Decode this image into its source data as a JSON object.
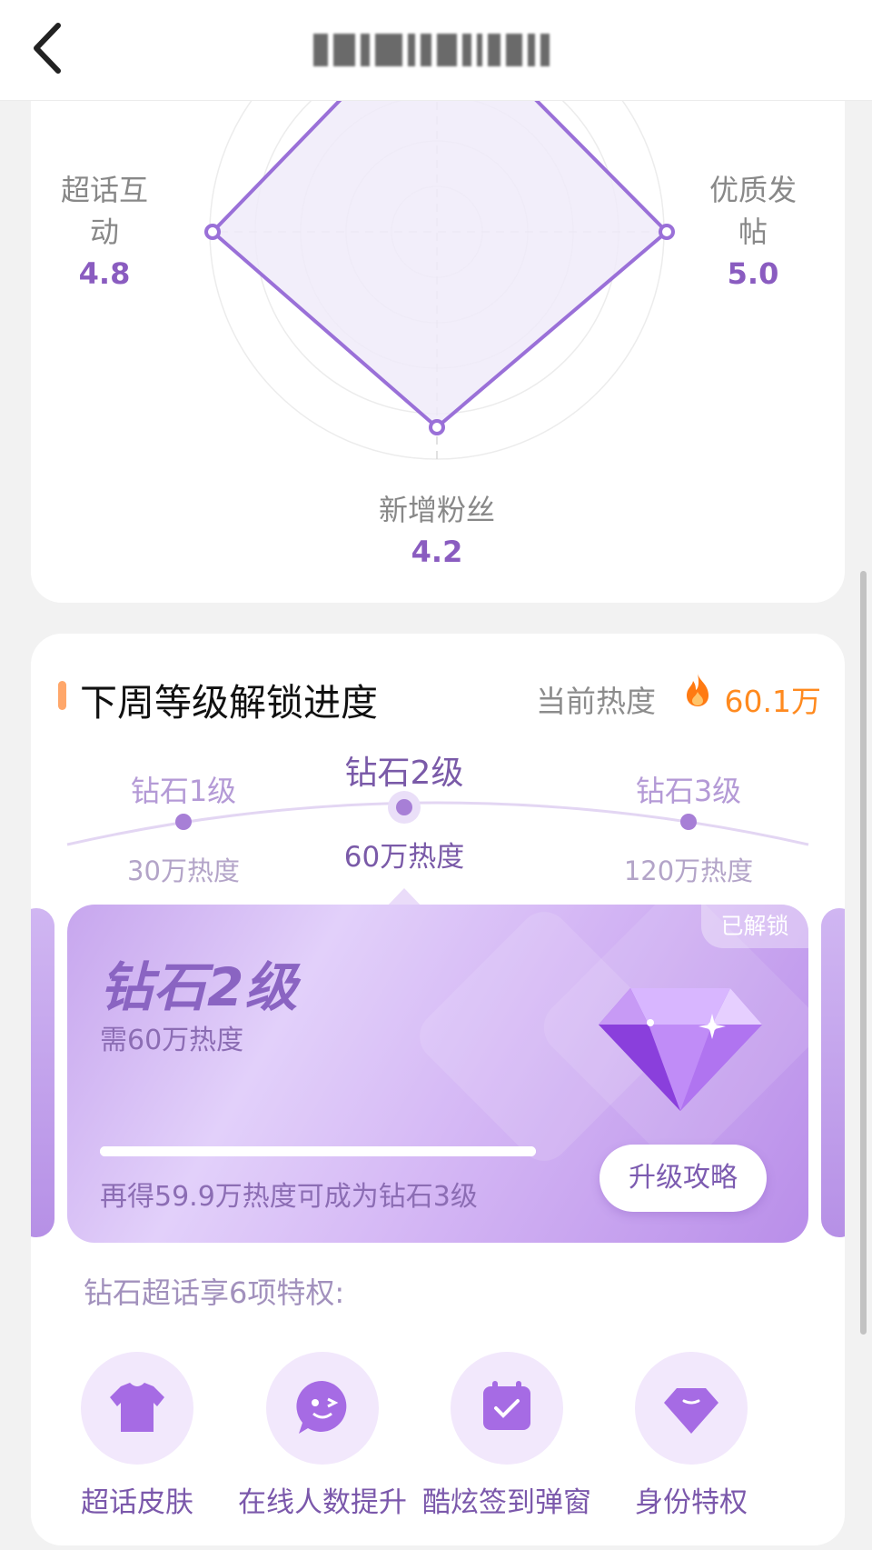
{
  "header": {
    "back_icon": "chevron-left-icon",
    "title": "(blurred)"
  },
  "radar": {
    "axes": [
      {
        "label": "超话互\n动",
        "value": "4.8"
      },
      {
        "label": "优质发\n帖",
        "value": "5.0"
      },
      {
        "label": "新增粉丝",
        "value": "4.2"
      }
    ],
    "colors": {
      "stroke": "#9a70d8",
      "fill": "#f0ebf9"
    }
  },
  "progress_section": {
    "title": "下周等级解锁进度",
    "current_heat_label": "当前热度",
    "current_heat_value": "60.1万",
    "flame_icon": "flame-icon",
    "levels": [
      {
        "name": "钻石1级",
        "heat": "30万热度"
      },
      {
        "name": "钻石2级",
        "heat": "60万热度"
      },
      {
        "name": "钻石3级",
        "heat": "120万热度"
      }
    ],
    "card": {
      "badge": "已解锁",
      "title": "钻石2级",
      "subtitle": "需60万热度",
      "progress": 1.0,
      "tip": "再得59.9万热度可成为钻石3级",
      "button": "升级攻略",
      "gem_icon": "diamond-gem-icon"
    },
    "privileges_title": "钻石超话享6项特权:",
    "privileges": [
      {
        "label": "超话皮肤",
        "icon": "tshirt-icon"
      },
      {
        "label": "在线人数提升",
        "icon": "chat-face-icon"
      },
      {
        "label": "酷炫签到弹窗",
        "icon": "calendar-check-icon"
      },
      {
        "label": "身份特权",
        "icon": "diamond-icon"
      }
    ]
  },
  "accent_colors": {
    "purple": "#8a5cc0",
    "orange": "#ff8a1f"
  }
}
